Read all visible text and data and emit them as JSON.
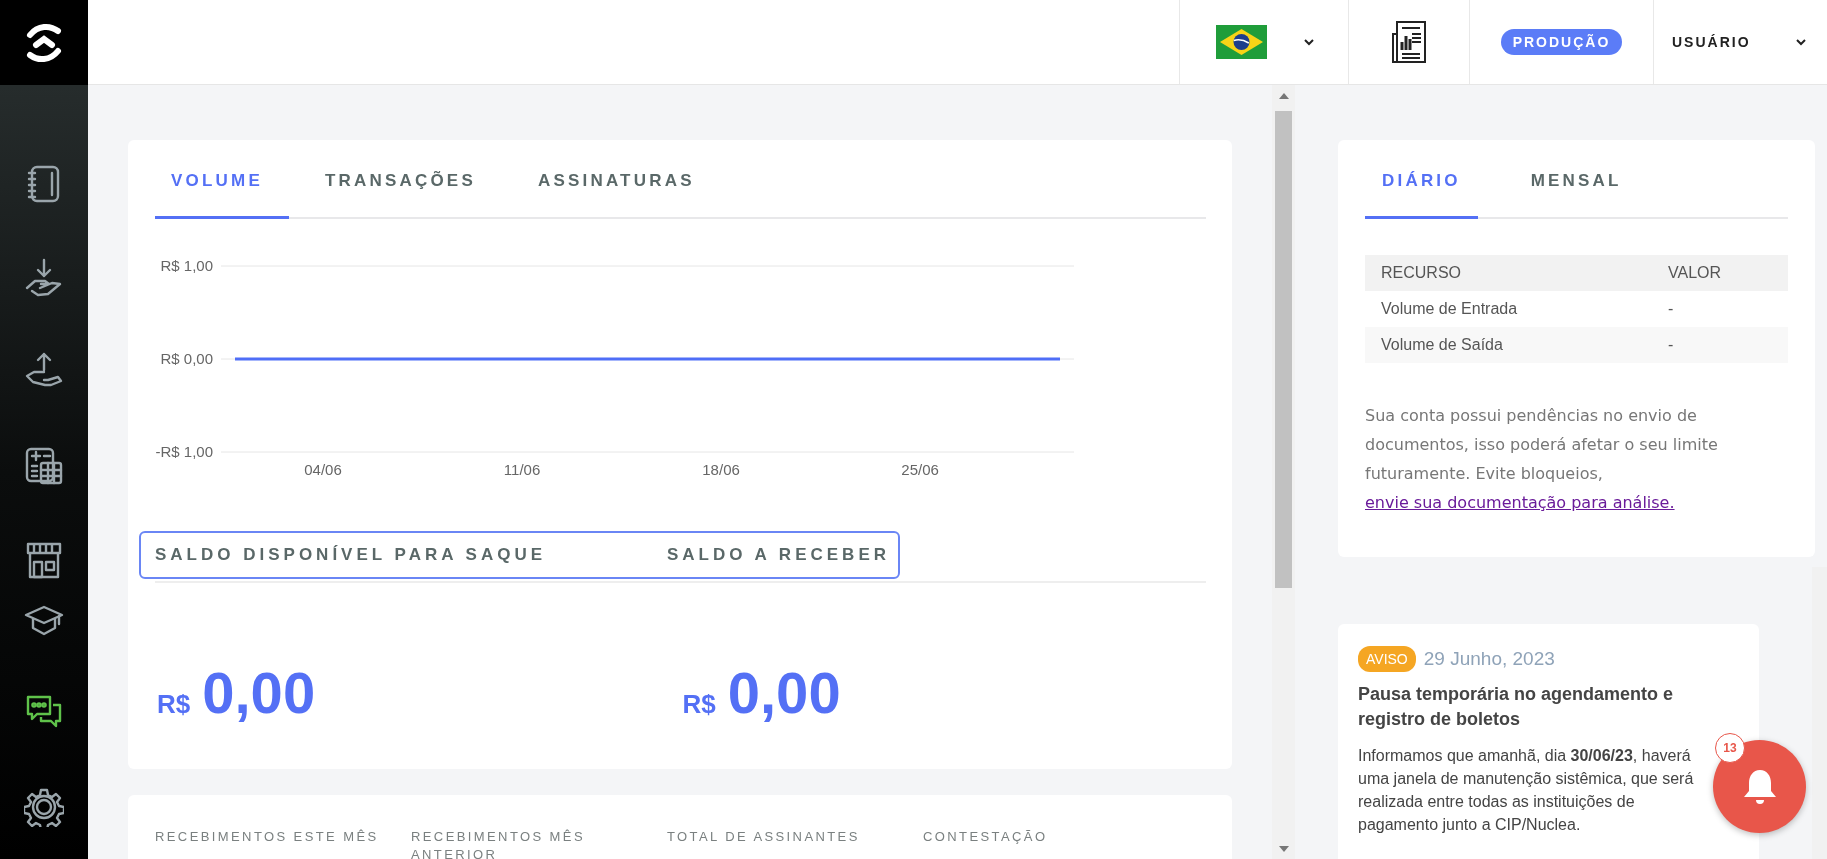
{
  "topbar": {
    "environment_badge": "PRODUÇÃO",
    "user_menu": "USUÁRIO"
  },
  "volume_card": {
    "tabs": [
      {
        "label": "VOLUME",
        "selected": true
      },
      {
        "label": "TRANSAÇÕES",
        "selected": false
      },
      {
        "label": "ASSINATURAS",
        "selected": false
      }
    ],
    "chart": {
      "y_labels": [
        "R$ 1,00",
        "R$ 0,00",
        "-R$ 1,00"
      ],
      "x_labels": [
        "04/06",
        "11/06",
        "18/06",
        "25/06"
      ]
    },
    "balance_tabs": [
      "SALDO DISPONÍVEL PARA SAQUE",
      "SALDO A RECEBER"
    ],
    "balances": [
      {
        "currency": "R$",
        "amount": "0,00"
      },
      {
        "currency": "R$",
        "amount": "0,00"
      }
    ]
  },
  "stats": [
    {
      "label": "RECEBIMENTOS ESTE MÊS"
    },
    {
      "label": "RECEBIMENTOS MÊS ANTERIOR"
    },
    {
      "label": "TOTAL DE ASSINANTES"
    },
    {
      "label": "CONTESTAÇÃO"
    }
  ],
  "daily_card": {
    "tabs": [
      {
        "label": "DIÁRIO",
        "selected": true
      },
      {
        "label": "MENSAL",
        "selected": false
      }
    ],
    "table": {
      "columns": [
        "RECURSO",
        "VALOR"
      ],
      "rows": [
        [
          "Volume de Entrada",
          "-"
        ],
        [
          "Volume de Saída",
          "-"
        ]
      ]
    },
    "notice": {
      "text": "Sua conta possui pendências no envio de documentos, isso poderá afetar o seu limite futuramente. Evite bloqueios,",
      "link": "envie sua documentação para análise."
    }
  },
  "news": {
    "tag": "AVISO",
    "date": "29 Junho, 2023",
    "title": "Pausa temporária no agendamento e registro de boletos",
    "body": "Informamos que amanhã, dia **30/06/23**, haverá uma janela de manutenção sistêmica, que será realizada entre todas as instituições de pagamento junto a CIP/Nuclea."
  },
  "notifications": {
    "count": "13"
  }
}
